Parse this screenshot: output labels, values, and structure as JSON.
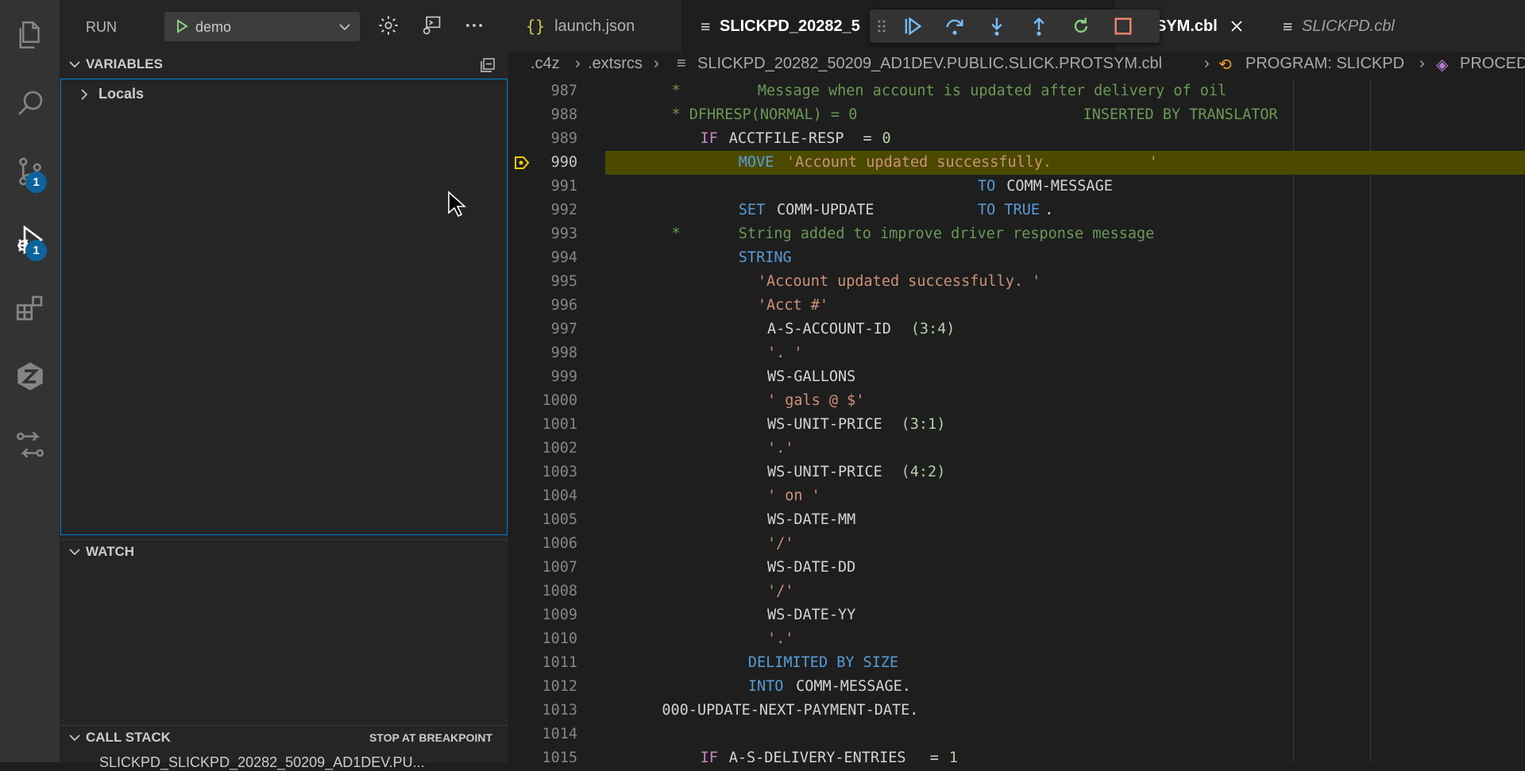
{
  "activity_bar": {
    "items": [
      {
        "icon": "explorer-icon"
      },
      {
        "icon": "search-icon"
      },
      {
        "icon": "source-control-icon",
        "badge": "1"
      },
      {
        "icon": "run-debug-icon",
        "badge": "1"
      },
      {
        "icon": "extensions-icon"
      },
      {
        "icon": "zowe-explorer-icon"
      },
      {
        "icon": "remote-icon"
      }
    ]
  },
  "sidebar": {
    "run_label": "RUN",
    "config_name": "demo",
    "variables": {
      "title": "VARIABLES",
      "locals": "Locals"
    },
    "watch": {
      "title": "WATCH"
    },
    "call_stack": {
      "title": "CALL STACK",
      "status": "STOP AT BREAKPOINT",
      "frame": "SLICKPD_SLICKPD_20282_50209_AD1DEV.PU..."
    }
  },
  "tabs": [
    {
      "icon": "{}",
      "label": "launch.json",
      "active": false,
      "italic": false
    },
    {
      "icon": "≡",
      "label": "SLICKPD_20282_5",
      "active": true,
      "italic": false
    },
    {
      "icon": "",
      "label": "SYM.cbl",
      "active": true,
      "italic": false
    },
    {
      "icon": "≡",
      "label": "SLICKPD.cbl",
      "active": false,
      "italic": true
    }
  ],
  "breadcrumb": [
    ".c4z",
    ".extsrcs",
    "SLICKPD_20282_50209_AD1DEV.PUBLIC.SLICK.PROTSYM.cbl",
    "PROGRAM: SLICKPD",
    "PROCED"
  ],
  "code": {
    "current_line": 990,
    "lines": [
      {
        "n": "987",
        "tokens": [
          {
            "t": "*",
            "c": "cmt",
            "col": 9
          },
          {
            "t": "Message when account is updated after delivery of oil",
            "c": "cmt",
            "col": 18
          }
        ]
      },
      {
        "n": "988",
        "tokens": [
          {
            "t": "* DFHRESP(NORMAL) = 0",
            "c": "cmt",
            "col": 9
          },
          {
            "t": "INSERTED BY TRANSLATOR",
            "c": "cmt",
            "col": 52
          }
        ]
      },
      {
        "n": "989",
        "tokens": [
          {
            "t": "IF",
            "c": "kw2",
            "col": 12
          },
          {
            "t": "ACCTFILE-RESP",
            "c": "id",
            "col": 15
          },
          {
            "t": "=",
            "c": "id",
            "col": 29
          },
          {
            "t": "0",
            "c": "num",
            "col": 31
          }
        ]
      },
      {
        "n": "990",
        "tokens": [
          {
            "t": "MOVE",
            "c": "kw",
            "col": 16
          },
          {
            "t": "'Account updated successfully.           '",
            "c": "str",
            "col": 21
          }
        ]
      },
      {
        "n": "991",
        "tokens": [
          {
            "t": "TO",
            "c": "kw",
            "col": 41
          },
          {
            "t": "COMM-MESSAGE",
            "c": "id",
            "col": 44
          }
        ]
      },
      {
        "n": "992",
        "tokens": [
          {
            "t": "SET",
            "c": "kw",
            "col": 16
          },
          {
            "t": "COMM-UPDATE",
            "c": "id",
            "col": 20
          },
          {
            "t": "TO TRUE",
            "c": "kw",
            "col": 41
          },
          {
            "t": ".",
            "c": "id",
            "col": 48
          }
        ]
      },
      {
        "n": "993",
        "tokens": [
          {
            "t": "*",
            "c": "cmt",
            "col": 9
          },
          {
            "t": "String added to improve driver response message",
            "c": "cmt",
            "col": 16
          }
        ]
      },
      {
        "n": "994",
        "tokens": [
          {
            "t": "STRING",
            "c": "kw",
            "col": 16
          }
        ]
      },
      {
        "n": "995",
        "tokens": [
          {
            "t": "'Account updated successfully. '",
            "c": "str",
            "col": 18
          }
        ]
      },
      {
        "n": "996",
        "tokens": [
          {
            "t": "'Acct #'",
            "c": "str",
            "col": 18
          }
        ]
      },
      {
        "n": "997",
        "tokens": [
          {
            "t": "A-S-ACCOUNT-ID",
            "c": "id",
            "col": 19
          },
          {
            "t": "(3:4)",
            "c": "num",
            "col": 34
          }
        ]
      },
      {
        "n": "998",
        "tokens": [
          {
            "t": "'. '",
            "c": "str",
            "col": 19
          }
        ]
      },
      {
        "n": "999",
        "tokens": [
          {
            "t": "WS-GALLONS",
            "c": "id",
            "col": 19
          }
        ]
      },
      {
        "n": "1000",
        "tokens": [
          {
            "t": "' gals @ $'",
            "c": "str",
            "col": 19
          }
        ]
      },
      {
        "n": "1001",
        "tokens": [
          {
            "t": "WS-UNIT-PRICE",
            "c": "id",
            "col": 19
          },
          {
            "t": "(3:1)",
            "c": "num",
            "col": 33
          }
        ]
      },
      {
        "n": "1002",
        "tokens": [
          {
            "t": "'.'",
            "c": "str",
            "col": 19
          }
        ]
      },
      {
        "n": "1003",
        "tokens": [
          {
            "t": "WS-UNIT-PRICE",
            "c": "id",
            "col": 19
          },
          {
            "t": "(4:2)",
            "c": "num",
            "col": 33
          }
        ]
      },
      {
        "n": "1004",
        "tokens": [
          {
            "t": "' on '",
            "c": "str",
            "col": 19
          }
        ]
      },
      {
        "n": "1005",
        "tokens": [
          {
            "t": "WS-DATE-MM",
            "c": "id",
            "col": 19
          }
        ]
      },
      {
        "n": "1006",
        "tokens": [
          {
            "t": "'/'",
            "c": "str",
            "col": 19
          }
        ]
      },
      {
        "n": "1007",
        "tokens": [
          {
            "t": "WS-DATE-DD",
            "c": "id",
            "col": 19
          }
        ]
      },
      {
        "n": "1008",
        "tokens": [
          {
            "t": "'/'",
            "c": "str",
            "col": 19
          }
        ]
      },
      {
        "n": "1009",
        "tokens": [
          {
            "t": "WS-DATE-YY",
            "c": "id",
            "col": 19
          }
        ]
      },
      {
        "n": "1010",
        "tokens": [
          {
            "t": "'.'",
            "c": "str",
            "col": 19
          }
        ]
      },
      {
        "n": "1011",
        "tokens": [
          {
            "t": "DELIMITED BY SIZE",
            "c": "kw",
            "col": 17
          }
        ]
      },
      {
        "n": "1012",
        "tokens": [
          {
            "t": "INTO",
            "c": "kw",
            "col": 17
          },
          {
            "t": "COMM-MESSAGE.",
            "c": "id",
            "col": 22
          }
        ]
      },
      {
        "n": "1013",
        "tokens": [
          {
            "t": "000-UPDATE-NEXT-PAYMENT-DATE.",
            "c": "id",
            "col": 8
          }
        ]
      },
      {
        "n": "1014",
        "tokens": []
      },
      {
        "n": "1015",
        "tokens": [
          {
            "t": "IF",
            "c": "kw2",
            "col": 12
          },
          {
            "t": "A-S-DELIVERY-ENTRIES",
            "c": "id",
            "col": 15
          },
          {
            "t": "=",
            "c": "id",
            "col": 36
          },
          {
            "t": "1",
            "c": "num",
            "col": 38
          }
        ]
      }
    ]
  },
  "colors": {
    "accent": "#007fd4",
    "badge": "#0e639c",
    "current_line_bg": "#4b4a00",
    "breakpoint_arrow": "#ffcc00"
  }
}
